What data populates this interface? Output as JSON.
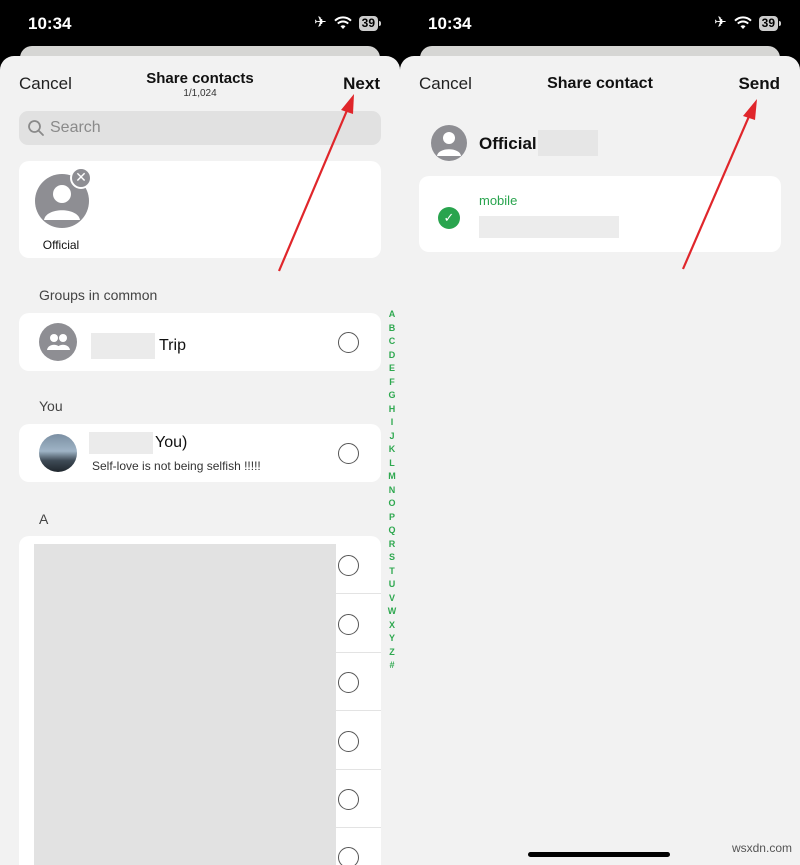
{
  "status": {
    "time": "10:34",
    "battery": "39"
  },
  "share_contacts": {
    "cancel_label": "Cancel",
    "title": "Share contacts",
    "subtitle": "1/1,024",
    "next_label": "Next",
    "search_placeholder": "Search",
    "selected": [
      {
        "name": "Official"
      }
    ],
    "groups_header": "Groups in common",
    "group_row": {
      "name": "Trip"
    },
    "you_header": "You",
    "you_row": {
      "name": "You)",
      "status": "Self-love is not being selfish !!!!!"
    },
    "a_header": "A",
    "index_letters": [
      "A",
      "B",
      "C",
      "D",
      "E",
      "F",
      "G",
      "H",
      "I",
      "J",
      "K",
      "L",
      "M",
      "N",
      "O",
      "P",
      "Q",
      "R",
      "S",
      "T",
      "U",
      "V",
      "W",
      "X",
      "Y",
      "Z",
      "#"
    ]
  },
  "share_contact": {
    "cancel_label": "Cancel",
    "title": "Share contact",
    "send_label": "Send",
    "contact_name": "Official",
    "phone_label": "mobile"
  },
  "watermark": "wsxdn.com",
  "colors": {
    "accent_green": "#29a44e",
    "annotation_red": "#e0262b",
    "sheet_bg": "#f2f2f2"
  },
  "icons": {
    "search": "search-icon",
    "remove": "close-icon",
    "group": "group-icon",
    "check": "check-icon",
    "airplane": "airplane-icon",
    "wifi": "wifi-icon"
  }
}
